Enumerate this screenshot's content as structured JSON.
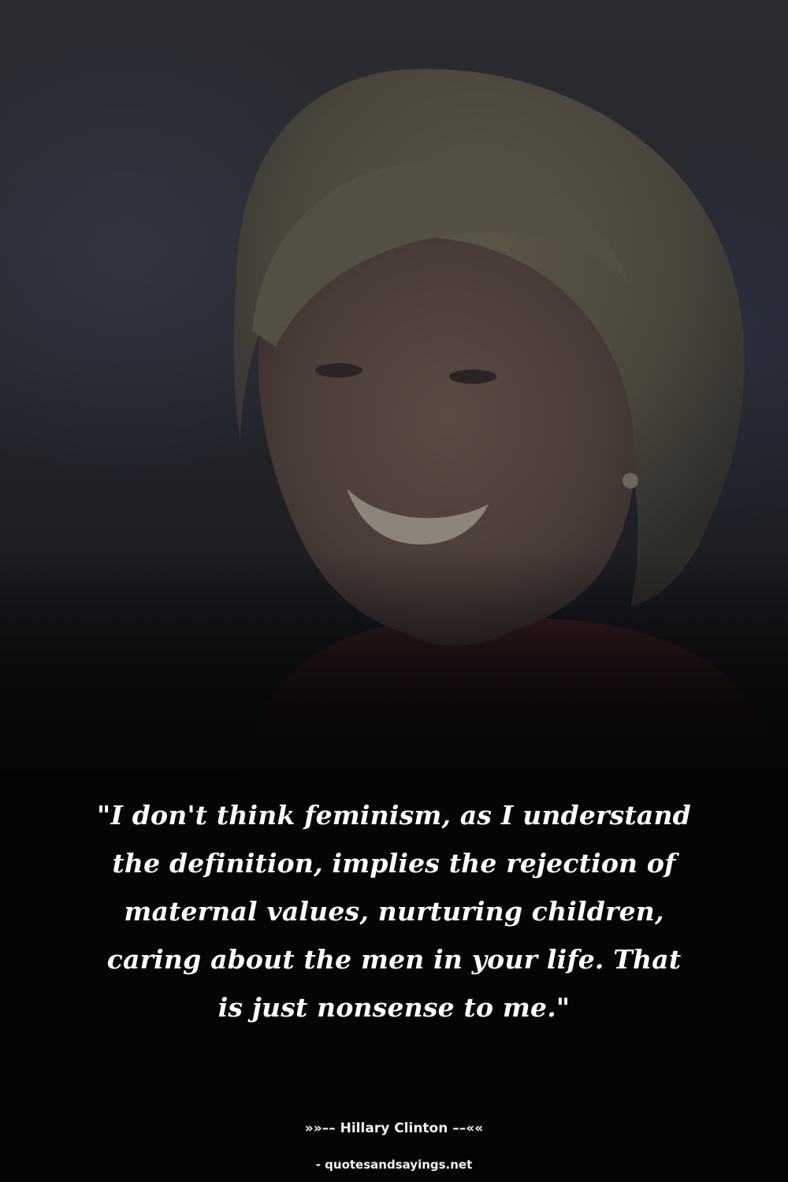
{
  "quote": {
    "text": "\"I don't think feminism, as I understand the definition, implies the rejection of maternal values, nurturing children, caring about the men in your life. That is just nonsense to me.\"",
    "attribution": "»»–– Hillary Clinton ––««"
  },
  "source": {
    "text": "- quotesandsayings.net"
  },
  "colors": {
    "background": "#050505",
    "text": "#ffffff"
  }
}
